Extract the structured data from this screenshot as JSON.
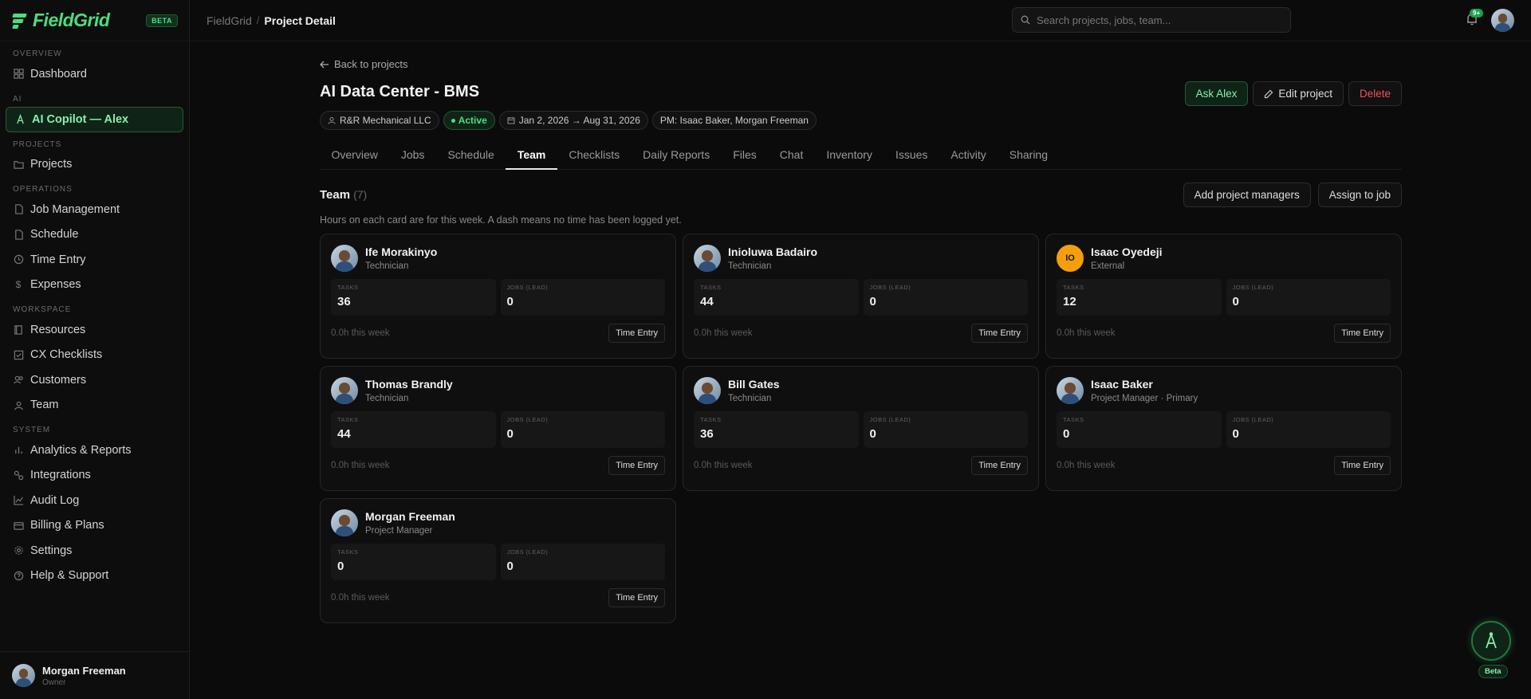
{
  "app": {
    "name": "FieldGrid",
    "beta": "BETA"
  },
  "sidebar": {
    "sections": {
      "overview": "OVERVIEW",
      "ai": "AI",
      "projects": "PROJECTS",
      "operations": "OPERATIONS",
      "workspace": "WORKSPACE",
      "system": "SYSTEM"
    },
    "items": {
      "dashboard": "Dashboard",
      "copilot": "AI Copilot — Alex",
      "projects": "Projects",
      "job_management": "Job Management",
      "schedule": "Schedule",
      "time_entry": "Time Entry",
      "expenses": "Expenses",
      "resources": "Resources",
      "cx_checklists": "CX Checklists",
      "customers": "Customers",
      "team": "Team",
      "analytics": "Analytics & Reports",
      "integrations": "Integrations",
      "audit_log": "Audit Log",
      "billing": "Billing & Plans",
      "settings": "Settings",
      "help": "Help & Support"
    },
    "user": {
      "name": "Morgan Freeman",
      "role": "Owner"
    }
  },
  "topbar": {
    "breadcrumb_root": "FieldGrid",
    "breadcrumb_sep": "/",
    "breadcrumb_current": "Project Detail",
    "search_placeholder": "Search projects, jobs, team...",
    "notifications": "9+"
  },
  "project": {
    "back": "Back to projects",
    "title": "AI Data Center - BMS",
    "actions": {
      "ask": "Ask Alex",
      "edit": "Edit project",
      "delete": "Delete"
    },
    "chips": {
      "company": "R&R Mechanical LLC",
      "status": "Active",
      "dates": "Jan 2, 2026 → Aug 31, 2026",
      "pm": "PM: Isaac Baker, Morgan Freeman"
    },
    "tabs": [
      "Overview",
      "Jobs",
      "Schedule",
      "Team",
      "Checklists",
      "Daily Reports",
      "Files",
      "Chat",
      "Inventory",
      "Issues",
      "Activity",
      "Sharing"
    ],
    "active_tab": "Team"
  },
  "team": {
    "title": "Team",
    "count": "(7)",
    "add_pm": "Add project managers",
    "assign": "Assign to job",
    "hint": "Hours on each card are for this week. A dash means no time has been logged yet.",
    "labels": {
      "tasks": "TASKS",
      "jobs": "JOBS (LEAD)",
      "time_entry": "Time Entry"
    },
    "members": [
      {
        "name": "Ife Morakinyo",
        "role": "Technician",
        "tasks": "36",
        "jobs": "0",
        "hours": "0.0h this week"
      },
      {
        "name": "Inioluwa Badairo",
        "role": "Technician",
        "tasks": "44",
        "jobs": "0",
        "hours": "0.0h this week"
      },
      {
        "name": "Isaac Oyedeji",
        "role": "External",
        "initials": "IO",
        "tasks": "12",
        "jobs": "0",
        "hours": "0.0h this week"
      },
      {
        "name": "Thomas Brandly",
        "role": "Technician",
        "tasks": "44",
        "jobs": "0",
        "hours": "0.0h this week"
      },
      {
        "name": "Bill Gates",
        "role": "Technician",
        "tasks": "36",
        "jobs": "0",
        "hours": "0.0h this week"
      },
      {
        "name": "Isaac Baker",
        "role": "Project Manager · Primary",
        "tasks": "0",
        "jobs": "0",
        "hours": "0.0h this week"
      },
      {
        "name": "Morgan Freeman",
        "role": "Project Manager",
        "tasks": "0",
        "jobs": "0",
        "hours": "0.0h this week"
      }
    ]
  },
  "fab": {
    "label": "Beta"
  },
  "colors": {
    "accent": "#4ade80",
    "danger": "#f05252",
    "initials_bg": "#f59e0b"
  }
}
